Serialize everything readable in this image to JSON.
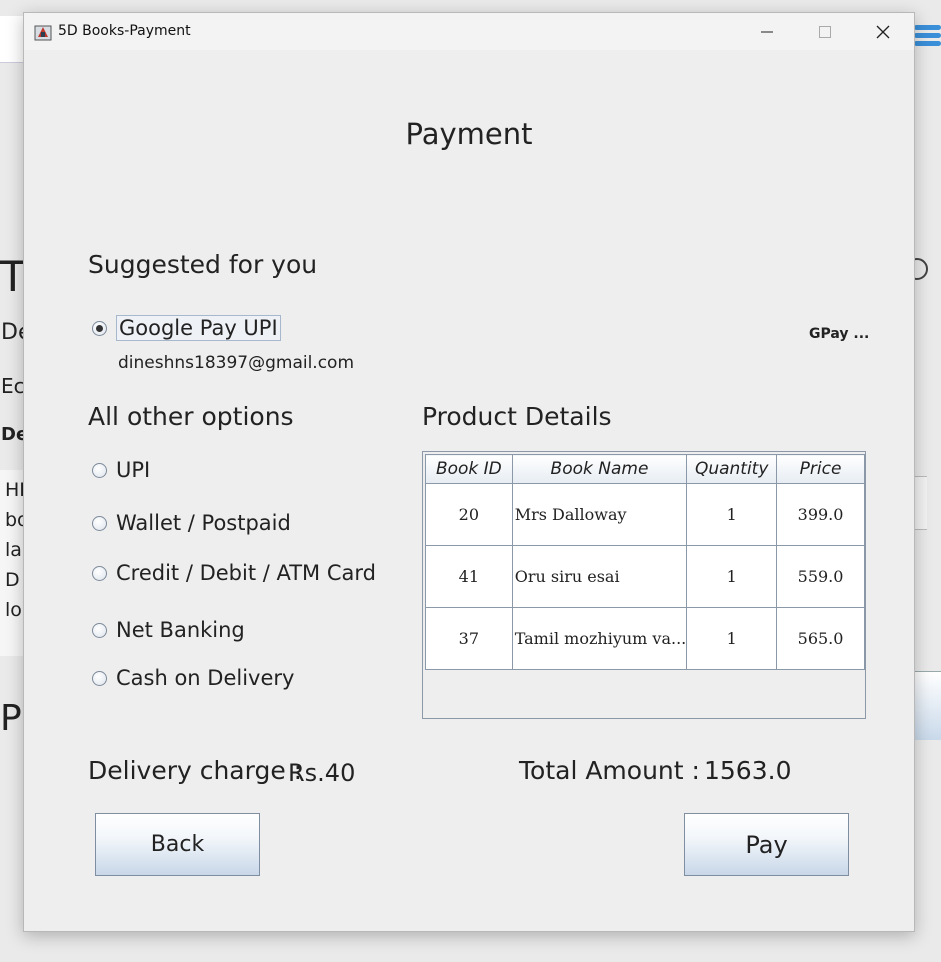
{
  "background": {
    "fragments": [
      "T",
      "De",
      "Ec",
      "De",
      "HI",
      "bo",
      "la",
      "D",
      "lo",
      "P"
    ]
  },
  "window": {
    "title": "5D Books-Payment",
    "controls": [
      "minimize",
      "maximize",
      "close"
    ]
  },
  "page": {
    "heading": "Payment"
  },
  "suggested": {
    "title": "Suggested for you",
    "option_label": "Google Pay UPI",
    "email": "dineshns18397@gmail.com",
    "gpay_label": "GPay ..."
  },
  "other_options": {
    "title": "All other options",
    "options": [
      "UPI",
      "Wallet / Postpaid",
      "Credit / Debit / ATM Card",
      "Net Banking",
      "Cash on Delivery"
    ]
  },
  "product_details": {
    "title": "Product Details",
    "columns": [
      "Book ID",
      "Book Name",
      "Quantity",
      "Price"
    ],
    "rows": [
      [
        "20",
        "Mrs Dalloway",
        "1",
        "399.0"
      ],
      [
        "41",
        "Oru siru esai",
        "1",
        "559.0"
      ],
      [
        "37",
        "Tamil mozhiyum va...",
        "1",
        "565.0"
      ]
    ]
  },
  "summary": {
    "delivery_label": "Delivery charge :",
    "delivery_value": "Rs.40",
    "total_label": "Total Amount :",
    "total_value": "1563.0"
  },
  "buttons": {
    "back": "Back",
    "pay": "Pay"
  }
}
